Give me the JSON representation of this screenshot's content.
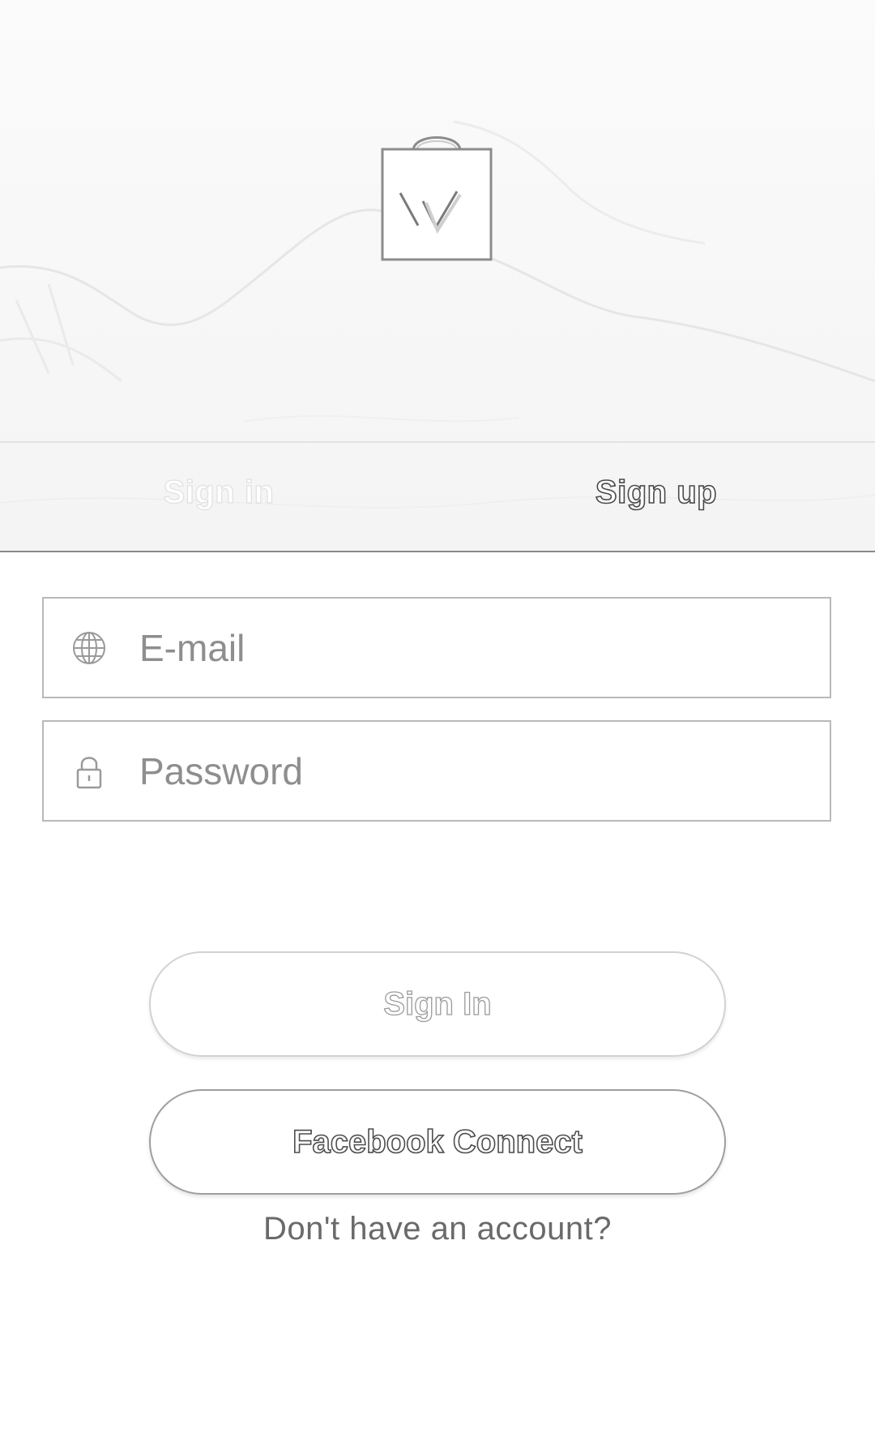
{
  "logo": {
    "letter": "W",
    "icon": "shopping-bag-icon"
  },
  "tabs": [
    {
      "label": "Sign in",
      "active": false
    },
    {
      "label": "Sign up",
      "active": true
    }
  ],
  "form": {
    "email": {
      "placeholder": "E-mail",
      "value": "",
      "icon": "globe-icon"
    },
    "password": {
      "placeholder": "Password",
      "value": "",
      "icon": "lock-icon"
    }
  },
  "buttons": {
    "signin": "Sign In",
    "facebook": "Facebook Connect"
  },
  "footer": {
    "no_account": "Don't have an account?"
  }
}
